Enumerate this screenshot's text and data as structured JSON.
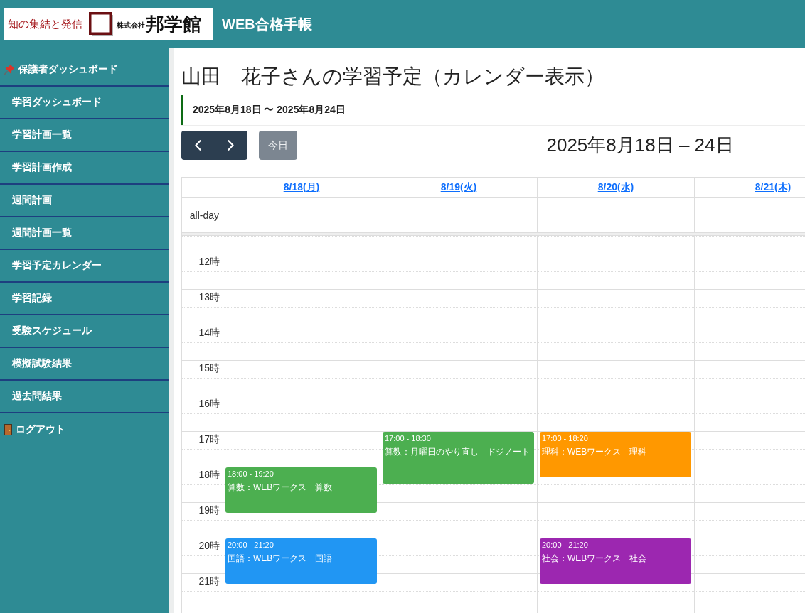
{
  "header": {
    "logo": {
      "tagline": "知の集結と発信",
      "company_type": "株式会社",
      "company_name": "邦学館"
    },
    "app_title": "WEB合格手帳"
  },
  "sidebar": {
    "items": [
      {
        "label": "保護者ダッシュボード",
        "kind": "section"
      },
      {
        "label": "学習ダッシュボード",
        "kind": "link"
      },
      {
        "label": "学習計画一覧",
        "kind": "link"
      },
      {
        "label": "学習計画作成",
        "kind": "link"
      },
      {
        "label": "週間計画",
        "kind": "link"
      },
      {
        "label": "週間計画一覧",
        "kind": "link"
      },
      {
        "label": "学習予定カレンダー",
        "kind": "link"
      },
      {
        "label": "学習記録",
        "kind": "link"
      },
      {
        "label": "受験スケジュール",
        "kind": "link"
      },
      {
        "label": "模擬試験結果",
        "kind": "link"
      },
      {
        "label": "過去問結果",
        "kind": "link"
      },
      {
        "label": "ログアウト",
        "kind": "logout"
      }
    ]
  },
  "page": {
    "title": "山田　花子さんの学習予定（カレンダー表示）",
    "date_range": "2025年8月18日 〜 2025年8月24日"
  },
  "toolbar": {
    "today_button": {
      "label": "今日",
      "disabled": true
    },
    "period_title": "2025年8月18日 – 24日"
  },
  "calendar": {
    "all_day_label": "all-day",
    "time_slots": [
      "12時",
      "13時",
      "14時",
      "15時",
      "16時",
      "17時",
      "18時",
      "19時",
      "20時",
      "21時"
    ],
    "days": [
      {
        "label": "8/18(月)",
        "events": [
          {
            "time": "18:00 - 19:20",
            "title": "算数：WEBワークス　算数",
            "color": "#4caf50"
          },
          {
            "time": "20:00 - 21:20",
            "title": "国語：WEBワークス　国語",
            "color": "#2196f3"
          }
        ]
      },
      {
        "label": "8/19(火)",
        "events": [
          {
            "time": "17:00 - 18:30",
            "title": "算数：月曜日のやり直し　ドジノート",
            "color": "#4caf50"
          }
        ]
      },
      {
        "label": "8/20(水)",
        "events": [
          {
            "time": "17:00 - 18:20",
            "title": "理科：WEBワークス　理科",
            "color": "#ff9800"
          },
          {
            "time": "20:00 - 21:20",
            "title": "社会：WEBワークス　社会",
            "color": "#9c27b0"
          }
        ]
      },
      {
        "label": "8/21(木)"
      }
    ]
  }
}
